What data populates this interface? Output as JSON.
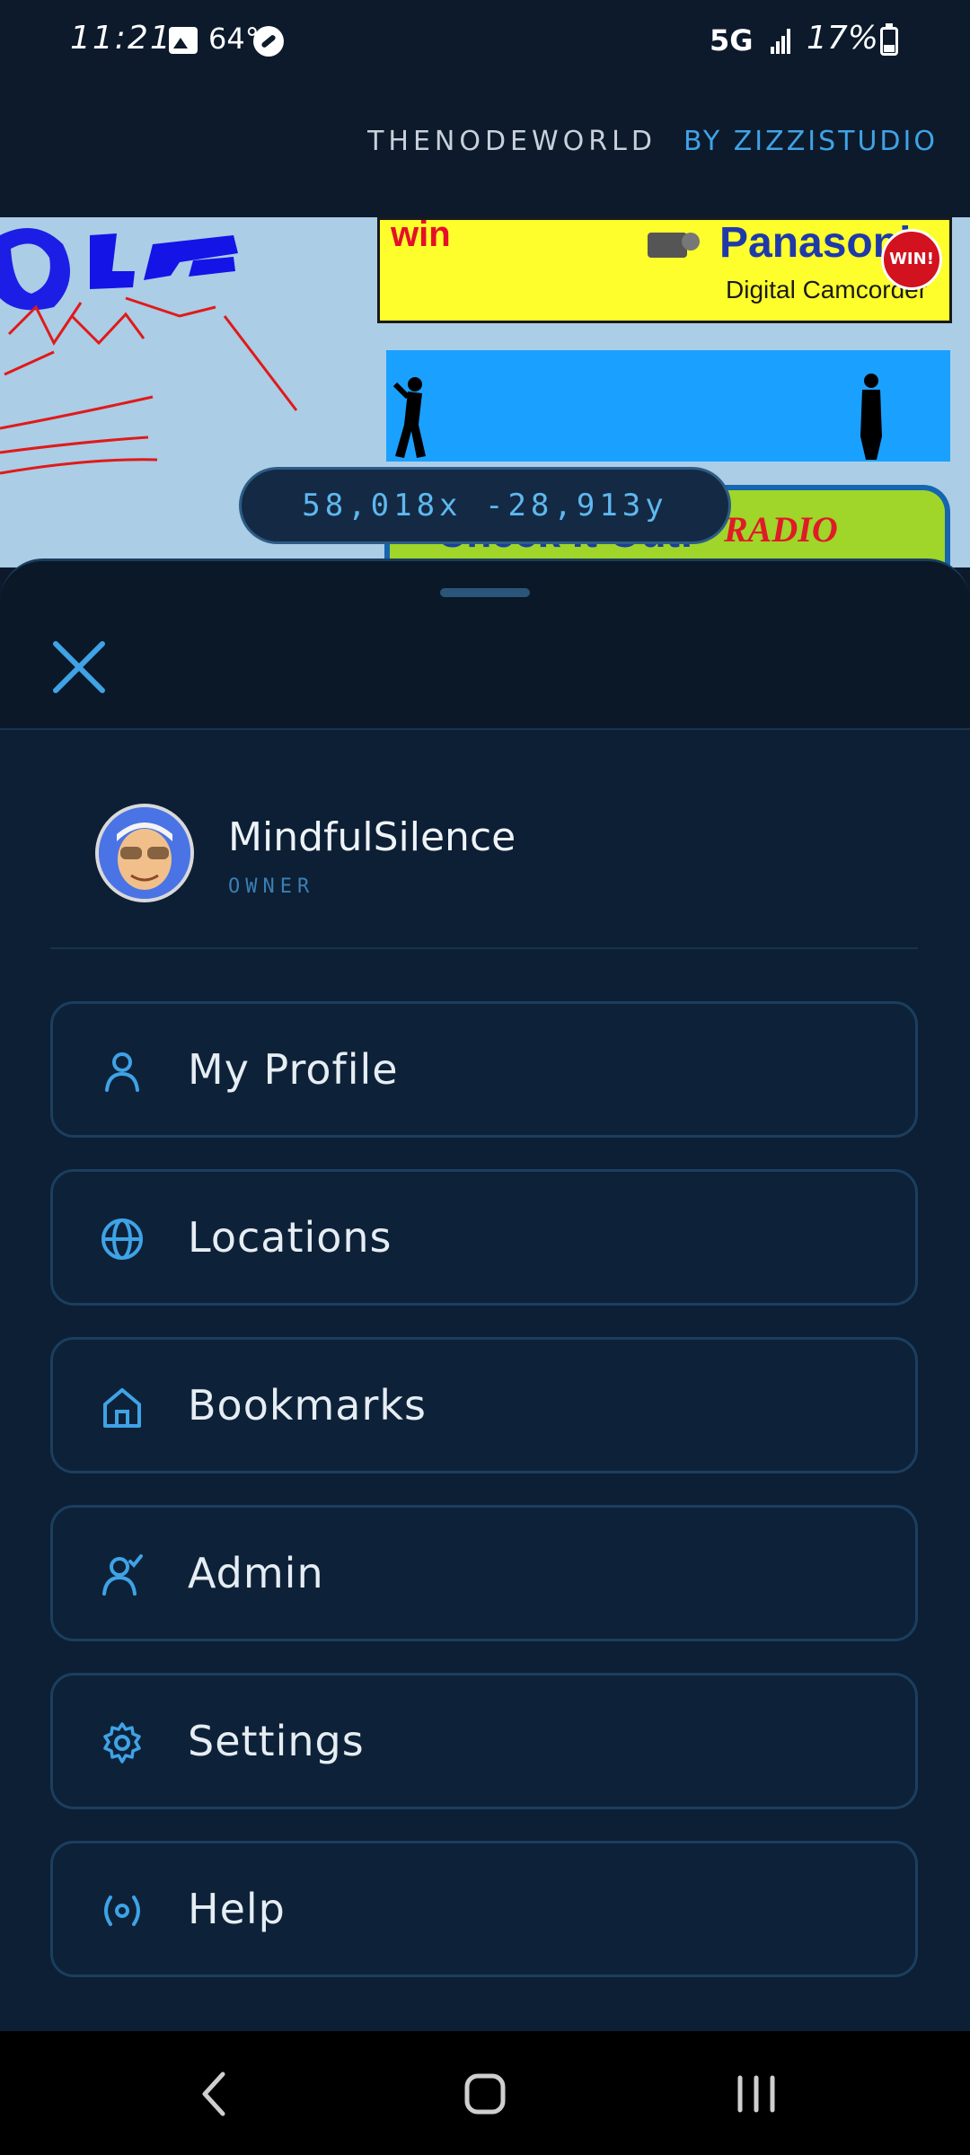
{
  "status_bar": {
    "time": "11:21",
    "temperature": "64°",
    "network": "5G",
    "battery": "17%",
    "icons": [
      "gallery-icon",
      "link-icon",
      "signal-icon",
      "battery-icon"
    ]
  },
  "header": {
    "brand": "THENODEWORLD",
    "byline": "BY ZIZZISTUDIO"
  },
  "map": {
    "coordinates": "58,018x -28,913y",
    "ads": {
      "panasonic_win": "win",
      "panasonic_brand": "Panasonic",
      "panasonic_sub": "Digital Camcorder",
      "panasonic_badge": "WIN!",
      "disney_check": "Check It Out!",
      "disney_brand": "RADIO Disney"
    }
  },
  "drawer": {
    "close_icon": "close-icon",
    "user": {
      "name": "MindfulSilence",
      "role": "OWNER"
    },
    "menu": [
      {
        "label": "My Profile",
        "icon": "user-icon"
      },
      {
        "label": "Locations",
        "icon": "globe-icon"
      },
      {
        "label": "Bookmarks",
        "icon": "home-icon"
      },
      {
        "label": "Admin",
        "icon": "admin-icon"
      },
      {
        "label": "Settings",
        "icon": "gear-icon"
      },
      {
        "label": "Help",
        "icon": "broadcast-icon"
      }
    ]
  },
  "nav": {
    "icons": [
      "back-icon",
      "home-nav-icon",
      "recents-icon"
    ]
  },
  "colors": {
    "background": "#0c1a2c",
    "accent": "#3fa3e6",
    "menu_bg": "#0d2239",
    "menu_border": "#1c3e5e"
  }
}
